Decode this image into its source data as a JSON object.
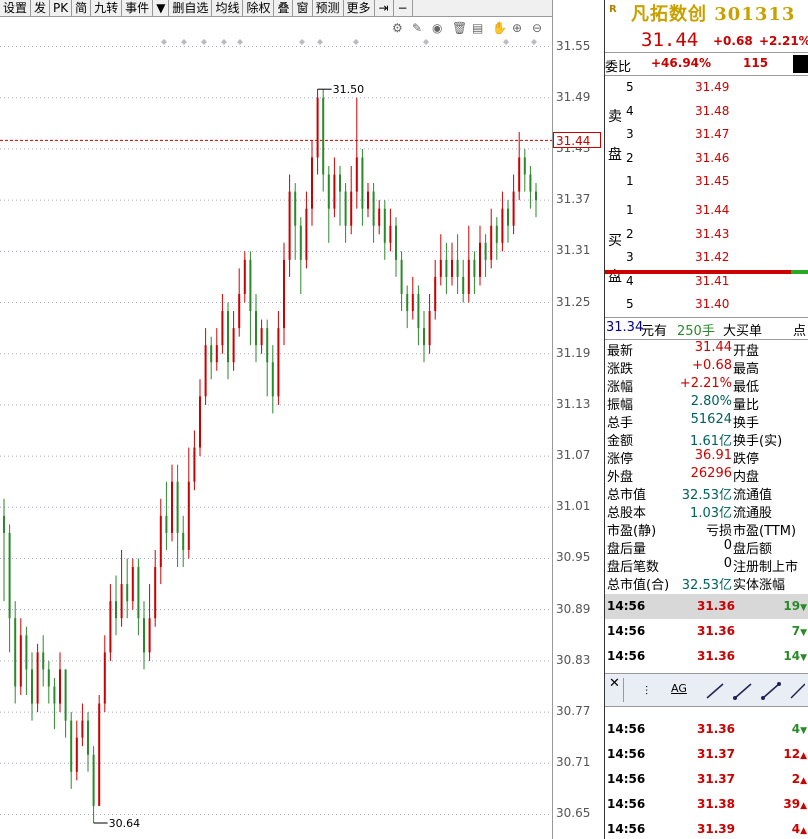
{
  "toolbar": {
    "items": [
      "设置",
      "发",
      "PK",
      "简",
      "九转",
      "事件",
      "▼",
      "删自选",
      "均线",
      "除权",
      "叠",
      "窗",
      "预测",
      "更多"
    ]
  },
  "chart_data": {
    "type": "candlestick",
    "y_ticks": [
      "31.55",
      "31.49",
      "31.43",
      "31.37",
      "31.31",
      "31.25",
      "31.19",
      "31.13",
      "31.07",
      "31.01",
      "30.95",
      "30.89",
      "30.83",
      "30.77",
      "30.71",
      "30.65"
    ],
    "ylim": [
      30.64,
      31.56
    ],
    "current_price": "31.44",
    "high_label": "31.50",
    "low_label": "30.64",
    "candles": [
      [
        31.0,
        30.98,
        30.9,
        31.02
      ],
      [
        30.98,
        30.88,
        30.84,
        30.99
      ],
      [
        30.88,
        30.8,
        30.78,
        30.9
      ],
      [
        30.8,
        30.86,
        30.79,
        30.88
      ],
      [
        30.86,
        30.82,
        30.79,
        30.87
      ],
      [
        30.82,
        30.78,
        30.76,
        30.84
      ],
      [
        30.78,
        30.84,
        30.77,
        30.85
      ],
      [
        30.84,
        30.82,
        30.8,
        30.86
      ],
      [
        30.82,
        30.8,
        30.78,
        30.83
      ],
      [
        30.8,
        30.78,
        30.75,
        30.81
      ],
      [
        30.78,
        30.82,
        30.77,
        30.84
      ],
      [
        30.82,
        30.76,
        30.74,
        30.82
      ],
      [
        30.76,
        30.7,
        30.68,
        30.77
      ],
      [
        30.7,
        30.74,
        30.69,
        30.76
      ],
      [
        30.74,
        30.76,
        30.73,
        30.78
      ],
      [
        30.76,
        30.72,
        30.7,
        30.77
      ],
      [
        30.72,
        30.66,
        30.64,
        30.73
      ],
      [
        30.66,
        30.78,
        30.66,
        30.79
      ],
      [
        30.78,
        30.84,
        30.77,
        30.86
      ],
      [
        30.84,
        30.9,
        30.83,
        30.92
      ],
      [
        30.9,
        30.88,
        30.86,
        30.93
      ],
      [
        30.88,
        30.92,
        30.87,
        30.96
      ],
      [
        30.92,
        30.9,
        30.88,
        30.95
      ],
      [
        30.9,
        30.94,
        30.89,
        30.95
      ],
      [
        30.94,
        30.88,
        30.86,
        30.95
      ],
      [
        30.88,
        30.84,
        30.82,
        30.9
      ],
      [
        30.84,
        30.88,
        30.83,
        30.92
      ],
      [
        30.88,
        30.94,
        30.87,
        30.96
      ],
      [
        30.94,
        31.0,
        30.92,
        31.02
      ],
      [
        31.0,
        30.98,
        30.96,
        31.04
      ],
      [
        30.98,
        31.04,
        30.97,
        31.06
      ],
      [
        31.04,
        30.98,
        30.94,
        31.06
      ],
      [
        30.98,
        30.96,
        30.94,
        31.0
      ],
      [
        30.96,
        31.04,
        30.95,
        31.08
      ],
      [
        31.04,
        31.08,
        31.03,
        31.1
      ],
      [
        31.08,
        31.14,
        31.07,
        31.16
      ],
      [
        31.14,
        31.2,
        31.13,
        31.22
      ],
      [
        31.2,
        31.18,
        31.16,
        31.21
      ],
      [
        31.18,
        31.2,
        31.17,
        31.22
      ],
      [
        31.2,
        31.24,
        31.19,
        31.26
      ],
      [
        31.24,
        31.18,
        31.16,
        31.25
      ],
      [
        31.18,
        31.22,
        31.17,
        31.24
      ],
      [
        31.22,
        31.26,
        31.21,
        31.29
      ],
      [
        31.26,
        31.3,
        31.25,
        31.31
      ],
      [
        31.3,
        31.24,
        31.2,
        31.31
      ],
      [
        31.24,
        31.2,
        31.18,
        31.26
      ],
      [
        31.2,
        31.22,
        31.19,
        31.23
      ],
      [
        31.22,
        31.18,
        31.14,
        31.23
      ],
      [
        31.18,
        31.14,
        31.12,
        31.2
      ],
      [
        31.14,
        31.22,
        31.13,
        31.24
      ],
      [
        31.22,
        31.3,
        31.2,
        31.32
      ],
      [
        31.3,
        31.38,
        31.28,
        31.4
      ],
      [
        31.38,
        31.34,
        31.3,
        31.39
      ],
      [
        31.34,
        31.3,
        31.26,
        31.35
      ],
      [
        31.3,
        31.36,
        31.29,
        31.38
      ],
      [
        31.36,
        31.42,
        31.34,
        31.44
      ],
      [
        31.42,
        31.49,
        31.4,
        31.5
      ],
      [
        31.49,
        31.4,
        31.38,
        31.5
      ],
      [
        31.4,
        31.36,
        31.32,
        31.41
      ],
      [
        31.36,
        31.4,
        31.35,
        31.42
      ],
      [
        31.4,
        31.38,
        31.34,
        31.41
      ],
      [
        31.38,
        31.34,
        31.32,
        31.39
      ],
      [
        31.34,
        31.38,
        31.33,
        31.41
      ],
      [
        31.38,
        31.42,
        31.36,
        31.49
      ],
      [
        31.42,
        31.36,
        31.34,
        31.43
      ],
      [
        31.36,
        31.38,
        31.35,
        31.39
      ],
      [
        31.38,
        31.34,
        31.32,
        31.39
      ],
      [
        31.34,
        31.36,
        31.33,
        31.37
      ],
      [
        31.36,
        31.32,
        31.3,
        31.37
      ],
      [
        31.32,
        31.34,
        31.31,
        31.36
      ],
      [
        31.34,
        31.3,
        31.28,
        31.35
      ],
      [
        31.3,
        31.26,
        31.24,
        31.31
      ],
      [
        31.26,
        31.24,
        31.22,
        31.27
      ],
      [
        31.24,
        31.26,
        31.23,
        31.28
      ],
      [
        31.26,
        31.22,
        31.2,
        31.27
      ],
      [
        31.22,
        31.2,
        31.18,
        31.24
      ],
      [
        31.2,
        31.24,
        31.19,
        31.26
      ],
      [
        31.24,
        31.28,
        31.23,
        31.3
      ],
      [
        31.28,
        31.3,
        31.27,
        31.33
      ],
      [
        31.3,
        31.28,
        31.26,
        31.32
      ],
      [
        31.28,
        31.3,
        31.27,
        31.32
      ],
      [
        31.3,
        31.28,
        31.26,
        31.33
      ],
      [
        31.28,
        31.26,
        31.25,
        31.3
      ],
      [
        31.26,
        31.3,
        31.25,
        31.34
      ],
      [
        31.3,
        31.28,
        31.26,
        31.31
      ],
      [
        31.28,
        31.32,
        31.27,
        31.34
      ],
      [
        31.32,
        31.3,
        31.28,
        31.33
      ],
      [
        31.3,
        31.34,
        31.29,
        31.36
      ],
      [
        31.34,
        31.32,
        31.3,
        31.35
      ],
      [
        31.32,
        31.36,
        31.31,
        31.38
      ],
      [
        31.36,
        31.34,
        31.32,
        31.37
      ],
      [
        31.34,
        31.38,
        31.33,
        31.4
      ],
      [
        31.38,
        31.42,
        31.37,
        31.45
      ],
      [
        31.42,
        31.4,
        31.38,
        31.43
      ],
      [
        31.4,
        31.38,
        31.36,
        31.41
      ],
      [
        31.38,
        31.37,
        31.35,
        31.39
      ]
    ]
  },
  "quote": {
    "badge": "R",
    "name": "凡拓数创 301313",
    "price": "31.44",
    "change": "+0.68",
    "pct": "+2.21%",
    "weibi_label": "委比",
    "weibi_value": "+46.94%",
    "weibi_diff": "115",
    "sell_label_1": "卖",
    "sell_label_2": "盘",
    "buy_label_1": "买",
    "buy_label_2": "盘",
    "asks": [
      {
        "lv": "5",
        "price": "31.49"
      },
      {
        "lv": "4",
        "price": "31.48"
      },
      {
        "lv": "3",
        "price": "31.47"
      },
      {
        "lv": "2",
        "price": "31.46"
      },
      {
        "lv": "1",
        "price": "31.45"
      }
    ],
    "bids": [
      {
        "lv": "1",
        "price": "31.44"
      },
      {
        "lv": "2",
        "price": "31.43"
      },
      {
        "lv": "3",
        "price": "31.42"
      },
      {
        "lv": "4",
        "price": "31.41"
      },
      {
        "lv": "5",
        "price": "31.40"
      }
    ],
    "bigbar": {
      "price": "31.34",
      "unit": "元有",
      "lots": "250手",
      "label": "大买单",
      "extra": "点"
    },
    "stats": [
      {
        "k": "最新",
        "v": "31.44",
        "k2": "开盘",
        "color": "#c00"
      },
      {
        "k": "涨跌",
        "v": "+0.68",
        "k2": "最高",
        "color": "#c00"
      },
      {
        "k": "涨幅",
        "v": "+2.21%",
        "k2": "最低",
        "color": "#c00"
      },
      {
        "k": "振幅",
        "v": "2.80%",
        "k2": "量比",
        "color": "#006060"
      },
      {
        "k": "总手",
        "v": "51624",
        "k2": "换手",
        "color": "#006060"
      },
      {
        "k": "金额",
        "v": "1.61亿",
        "k2": "换手(实)",
        "color": "#006060"
      },
      {
        "k": "涨停",
        "v": "36.91",
        "k2": "跌停",
        "color": "#c00"
      },
      {
        "k": "外盘",
        "v": "26296",
        "k2": "内盘",
        "color": "#c00"
      },
      {
        "k": "总市值",
        "v": "32.53亿",
        "k2": "流通值",
        "color": "#006060"
      },
      {
        "k": "总股本",
        "v": "1.03亿",
        "k2": "流通股",
        "color": "#006060"
      },
      {
        "k": "市盈(静)",
        "v": "亏损",
        "k2": "市盈(TTM)",
        "color": "#000"
      },
      {
        "k": "盘后量",
        "v": "0",
        "k2": "盘后额",
        "color": "#000"
      },
      {
        "k": "盘后笔数",
        "v": "0",
        "k2": "注册制上市",
        "color": "#000"
      },
      {
        "k": "总市值(合)",
        "v": "32.53亿",
        "k2": "实体涨幅",
        "color": "#006060"
      }
    ],
    "ticks_top": [
      {
        "t": "14:56",
        "p": "31.36",
        "v": "19",
        "dir": "down"
      },
      {
        "t": "14:56",
        "p": "31.36",
        "v": "7",
        "dir": "down"
      },
      {
        "t": "14:56",
        "p": "31.36",
        "v": "14",
        "dir": "down"
      }
    ],
    "ticks_bottom": [
      {
        "t": "14:56",
        "p": "31.36",
        "v": "4",
        "dir": "down"
      },
      {
        "t": "14:56",
        "p": "31.37",
        "v": "12",
        "dir": "up"
      },
      {
        "t": "14:56",
        "p": "31.37",
        "v": "2",
        "dir": "up"
      },
      {
        "t": "14:56",
        "p": "31.38",
        "v": "39",
        "dir": "up"
      },
      {
        "t": "14:56",
        "p": "31.39",
        "v": "4",
        "dir": "up"
      }
    ],
    "drawbar_label": "AG"
  }
}
